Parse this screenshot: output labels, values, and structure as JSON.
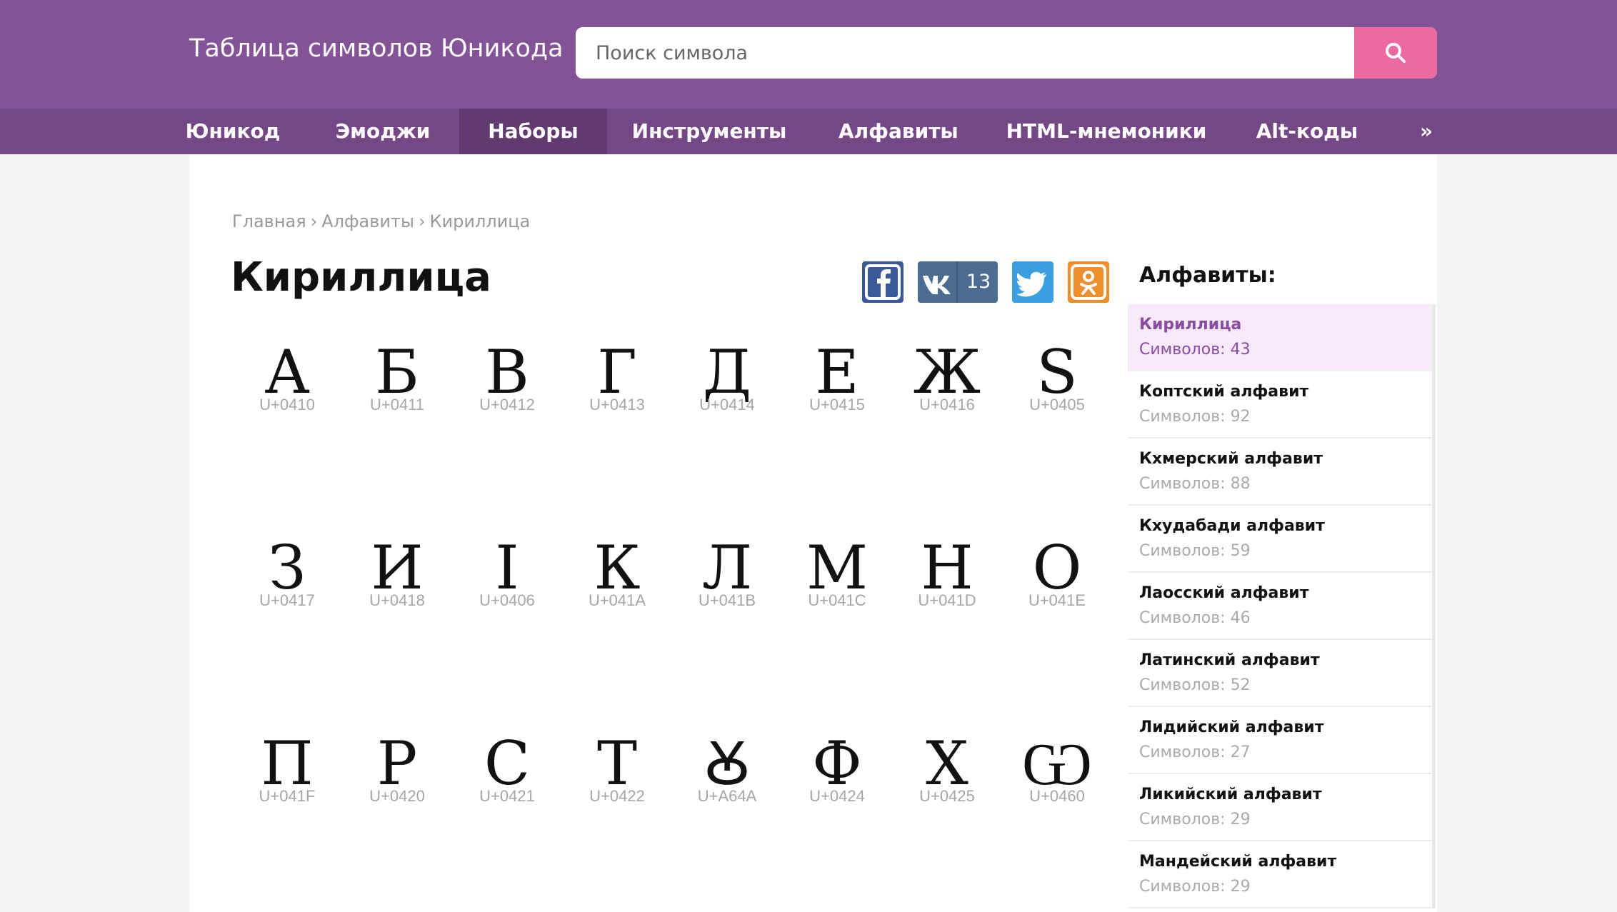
{
  "header": {
    "site_title": "Таблица символов Юникода",
    "search_placeholder": "Поиск символа",
    "search_icon": "search-icon"
  },
  "nav": {
    "items": [
      {
        "label": "Юникод"
      },
      {
        "label": "Эмоджи"
      },
      {
        "label": "Наборы",
        "active": true
      },
      {
        "label": "Инструменты"
      },
      {
        "label": "Алфавиты"
      },
      {
        "label": "HTML-мнемоники"
      },
      {
        "label": "Alt-коды"
      },
      {
        "label": "»"
      }
    ]
  },
  "breadcrumb": {
    "items": [
      "Главная",
      "Алфавиты",
      "Кириллица"
    ],
    "separator": "›"
  },
  "page": {
    "title": "Кириллица"
  },
  "share": {
    "facebook_icon": "facebook-icon",
    "vk_icon": "vk-icon",
    "vk_count": "13",
    "twitter_icon": "twitter-icon",
    "odnoklassniki_icon": "odnoklassniki-icon"
  },
  "symbols": [
    {
      "char": "А",
      "code": "U+0410"
    },
    {
      "char": "Б",
      "code": "U+0411"
    },
    {
      "char": "В",
      "code": "U+0412"
    },
    {
      "char": "Г",
      "code": "U+0413"
    },
    {
      "char": "Д",
      "code": "U+0414"
    },
    {
      "char": "Е",
      "code": "U+0415"
    },
    {
      "char": "Ж",
      "code": "U+0416"
    },
    {
      "char": "Ѕ",
      "code": "U+0405"
    },
    {
      "char": "З",
      "code": "U+0417"
    },
    {
      "char": "И",
      "code": "U+0418"
    },
    {
      "char": "І",
      "code": "U+0406"
    },
    {
      "char": "К",
      "code": "U+041A"
    },
    {
      "char": "Л",
      "code": "U+041B"
    },
    {
      "char": "М",
      "code": "U+041C"
    },
    {
      "char": "Н",
      "code": "U+041D"
    },
    {
      "char": "О",
      "code": "U+041E"
    },
    {
      "char": "П",
      "code": "U+041F"
    },
    {
      "char": "Р",
      "code": "U+0420"
    },
    {
      "char": "С",
      "code": "U+0421"
    },
    {
      "char": "Т",
      "code": "U+0422"
    },
    {
      "char": "Ꙋ",
      "code": "U+A64A"
    },
    {
      "char": "Ф",
      "code": "U+0424"
    },
    {
      "char": "Х",
      "code": "U+0425"
    },
    {
      "char": "Ѡ",
      "code": "U+0460"
    }
  ],
  "sidebar": {
    "title": "Алфавиты:",
    "items": [
      {
        "name": "Кириллица",
        "count": "Символов: 43",
        "active": true
      },
      {
        "name": "Коптский алфавит",
        "count": "Символов: 92"
      },
      {
        "name": "Кхмерский алфавит",
        "count": "Символов: 88"
      },
      {
        "name": "Кхудабади алфавит",
        "count": "Символов: 59"
      },
      {
        "name": "Лаосский алфавит",
        "count": "Символов: 46"
      },
      {
        "name": "Латинский алфавит",
        "count": "Символов: 52"
      },
      {
        "name": "Лидийский алфавит",
        "count": "Символов: 27"
      },
      {
        "name": "Ликийский алфавит",
        "count": "Символов: 29"
      },
      {
        "name": "Мандейский алфавит",
        "count": "Символов: 29"
      }
    ]
  },
  "colors": {
    "header_bg": "#845297",
    "nav_bg": "#744886",
    "nav_active_bg": "#613a70",
    "search_button": "#ec6a9f",
    "active_item_bg": "#f8e9fb",
    "active_item_text": "#8a4ca0"
  }
}
